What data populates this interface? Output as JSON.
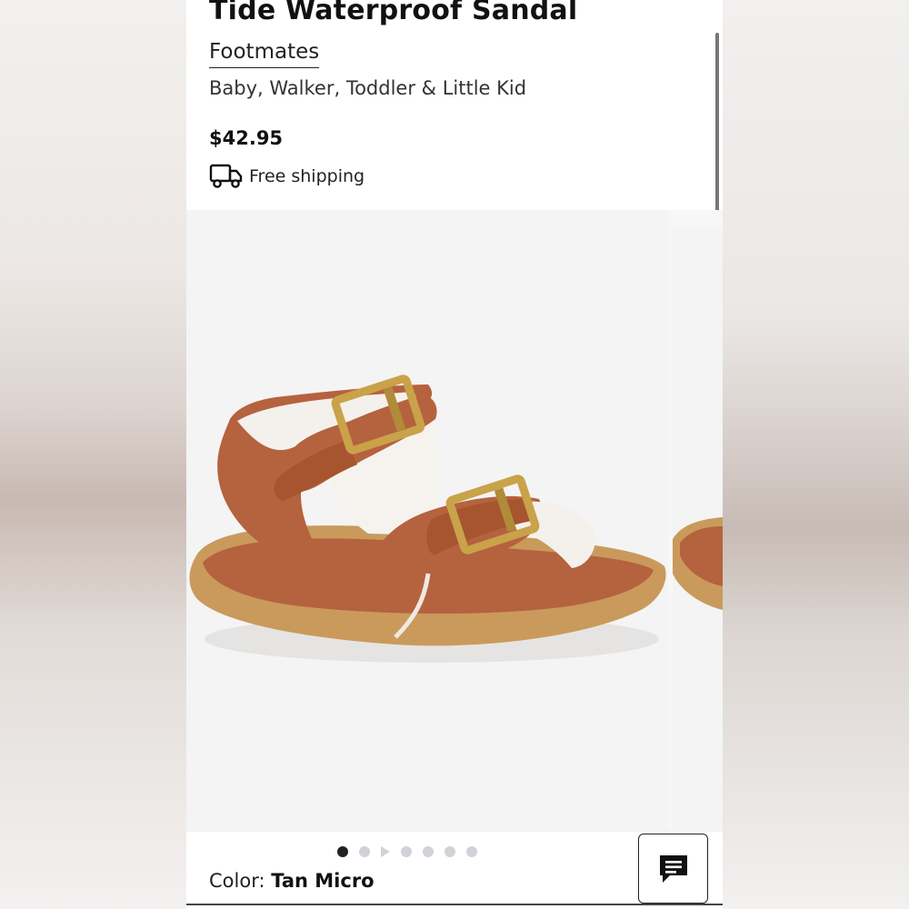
{
  "product": {
    "title": "Tide Waterproof Sandal",
    "brand": "Footmates",
    "subtitle": "Baby, Walker, Toddler & Little Kid",
    "price": "$42.95",
    "shipping_label": "Free shipping",
    "shipping_icon": "truck-icon"
  },
  "gallery": {
    "active_index": 0,
    "dot_count": 7,
    "video_dot_index": 2
  },
  "color": {
    "label": "Color:",
    "value": "Tan Micro"
  },
  "chat": {
    "icon": "chat-icon"
  },
  "colors": {
    "text": "#111111",
    "sandal_leather": "#b5623f",
    "sole": "#c99a5c",
    "buckle": "#c9a24a"
  }
}
